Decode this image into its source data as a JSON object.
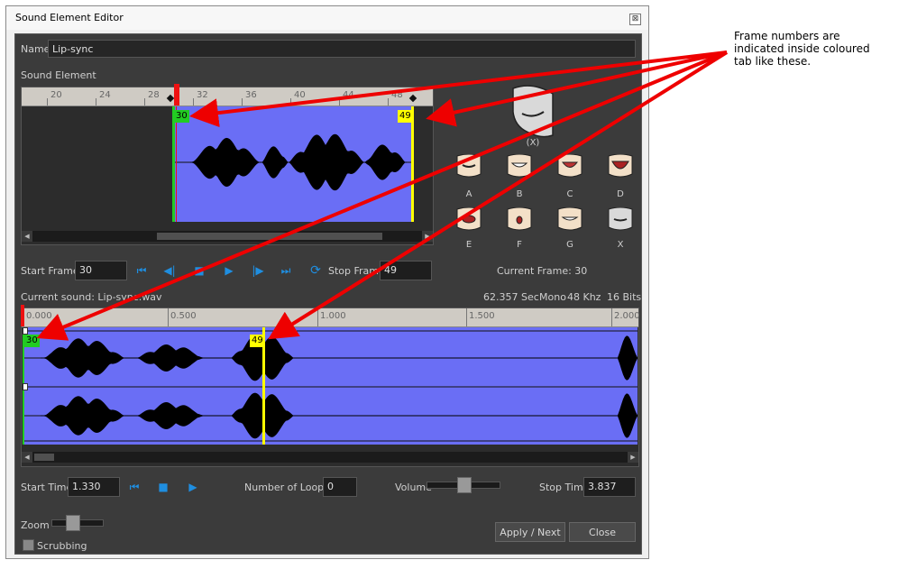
{
  "window": {
    "title": "Sound Element Editor",
    "close_glyph": "⊠"
  },
  "name_field": {
    "label": "Name",
    "value": "Lip-sync"
  },
  "sound_element": {
    "label": "Sound Element",
    "ruler_ticks": [
      "20",
      "24",
      "28",
      "32",
      "36",
      "40",
      "44",
      "48"
    ],
    "start_tag": "30",
    "stop_tag": "49"
  },
  "mouths": {
    "big_label": "(X)",
    "labels": [
      "A",
      "B",
      "C",
      "D",
      "E",
      "F",
      "G",
      "X"
    ]
  },
  "frame_controls": {
    "start_frame_label": "Start Frame",
    "start_frame_value": "30",
    "stop_frame_label": "Stop Frame",
    "stop_frame_value": "49",
    "current_frame": "Current Frame: 30"
  },
  "sound_info": {
    "current_sound": "Current sound: Lip-sync.wav",
    "duration": "62.357 Sec",
    "channels": "Mono",
    "rate": "48 Khz",
    "bits": "16 Bits"
  },
  "time_ruler": {
    "ticks": [
      "0.000",
      "0.500",
      "1.000",
      "1.500",
      "2.000"
    ]
  },
  "time_tags": {
    "start": "30",
    "stop": "49"
  },
  "time_controls": {
    "start_time_label": "Start Time",
    "start_time_value": "1.330",
    "loops_label": "Number of Loops:",
    "loops_value": "0",
    "volume_label": "Volume",
    "volume_level": 0.5,
    "stop_time_label": "Stop Time",
    "stop_time_value": "3.837"
  },
  "bottom": {
    "zoom_label": "Zoom",
    "zoom_level": 0.35,
    "scrubbing_label": "Scrubbing",
    "scrubbing_checked": false,
    "apply_label": "Apply / Next",
    "close_label": "Close"
  },
  "annotation": "Frame numbers are indicated inside coloured tab like these.",
  "colors": {
    "waveform_bg": "#6a6ef5",
    "start_marker": "#22cc22",
    "stop_marker": "#ffff00",
    "arrow": "#ff0000"
  }
}
